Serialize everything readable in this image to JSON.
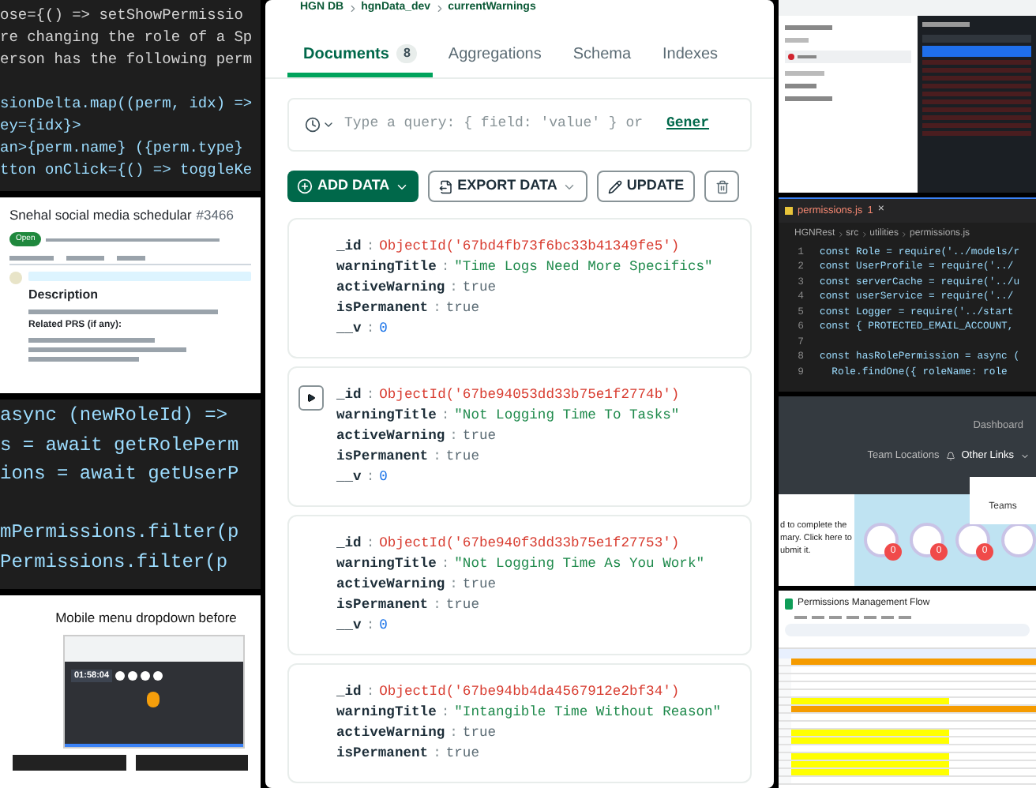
{
  "code_top": {
    "blocks": [
      [
        "ose={() => setShowPermissio",
        "re changing the role of a Sp",
        "erson has the following perm"
      ],
      [
        "sionDelta.map((perm, idx) =>",
        "ey={idx}>",
        "an>{perm.name} ({perm.type}",
        "tton onClick={() => toggleKe"
      ]
    ]
  },
  "issue": {
    "title": "Snehal social media schedular",
    "number": "#3466",
    "status": "Open",
    "heading": "Description",
    "related": "Related PRS (if any):"
  },
  "code_mid": {
    "blocks": [
      [
        "async (newRoleId) =>",
        "s = await getRolePerm",
        "ions = await getUserP"
      ],
      [
        "mPermissions.filter(p",
        "Permissions.filter(p"
      ]
    ]
  },
  "mobile_menu": {
    "caption": "Mobile menu dropdown before",
    "timer": "01:58:04"
  },
  "compass": {
    "separator": ":",
    "breadcrumb": [
      "HGN DB",
      "hgnData_dev",
      "currentWarnings"
    ],
    "tabs": [
      {
        "label": "Documents",
        "count": "8",
        "selected": true
      },
      {
        "label": "Aggregations",
        "selected": false
      },
      {
        "label": "Schema",
        "selected": false
      },
      {
        "label": "Indexes",
        "selected": false
      }
    ],
    "query": {
      "placeholder": "Type a query: { field: 'value' } or",
      "link": "Gener"
    },
    "buttons": [
      {
        "label": "ADD DATA",
        "kind": "primary"
      },
      {
        "label": "EXPORT DATA",
        "kind": "export"
      },
      {
        "label": "UPDATE",
        "kind": "update"
      },
      {
        "kind": "delete"
      }
    ],
    "documents": [
      {
        "expandable": false,
        "fields": [
          {
            "key": "_id",
            "value": "ObjectId('67bd4fb73f6bc33b41349fe5')",
            "kind": "oid"
          },
          {
            "key": "warningTitle",
            "value": "\"Time Logs Need More Specifics\"",
            "kind": "string"
          },
          {
            "key": "activeWarning",
            "value": "true",
            "kind": "bool"
          },
          {
            "key": "isPermanent",
            "value": "true",
            "kind": "bool"
          },
          {
            "key": "__v",
            "value": "0",
            "kind": "number"
          }
        ]
      },
      {
        "expandable": true,
        "fields": [
          {
            "key": "_id",
            "value": "ObjectId('67be94053dd33b75e1f2774b')",
            "kind": "oid"
          },
          {
            "key": "warningTitle",
            "value": "\"Not Logging Time To Tasks\"",
            "kind": "string"
          },
          {
            "key": "activeWarning",
            "value": "true",
            "kind": "bool"
          },
          {
            "key": "isPermanent",
            "value": "true",
            "kind": "bool"
          },
          {
            "key": "__v",
            "value": "0",
            "kind": "number"
          }
        ]
      },
      {
        "expandable": false,
        "fields": [
          {
            "key": "_id",
            "value": "ObjectId('67be940f3dd33b75e1f27753')",
            "kind": "oid"
          },
          {
            "key": "warningTitle",
            "value": "\"Not Logging Time As You Work\"",
            "kind": "string"
          },
          {
            "key": "activeWarning",
            "value": "true",
            "kind": "bool"
          },
          {
            "key": "isPermanent",
            "value": "true",
            "kind": "bool"
          },
          {
            "key": "__v",
            "value": "0",
            "kind": "number"
          }
        ]
      },
      {
        "expandable": false,
        "fields": [
          {
            "key": "_id",
            "value": "ObjectId('67be94bb4da4567912e2bf34')",
            "kind": "oid"
          },
          {
            "key": "warningTitle",
            "value": "\"Intangible Time Without Reason\"",
            "kind": "string"
          },
          {
            "key": "activeWarning",
            "value": "true",
            "kind": "bool"
          },
          {
            "key": "isPermanent",
            "value": "true",
            "kind": "bool"
          }
        ]
      }
    ]
  },
  "editor": {
    "tab": "permissions.js",
    "tab_badge": "1",
    "close": "×",
    "breadcrumb": [
      "HGNRest",
      "src",
      "utilities",
      "permissions.js"
    ],
    "lines": [
      {
        "n": "1",
        "text": "const Role = require('../models/r"
      },
      {
        "n": "2",
        "text": "const UserProfile = require('../"
      },
      {
        "n": "3",
        "text": "const serverCache = require('../u"
      },
      {
        "n": "4",
        "text": "const userService = require('../"
      },
      {
        "n": "5",
        "text": "const Logger = require('../start"
      },
      {
        "n": "6",
        "text": "const { PROTECTED_EMAIL_ACCOUNT,"
      },
      {
        "n": "7"
      },
      {
        "n": "8",
        "text": "const hasRolePermission = async ("
      },
      {
        "n": "9",
        "text": "  Role.findOne({ roleName: role"
      }
    ]
  },
  "dashboard": {
    "nav_right": "Dashboard",
    "links": [
      "Team Locations",
      "Other Links"
    ],
    "dropdown_item": "Teams",
    "message": [
      "d to complete the",
      "mary. Click here to",
      "ubmit it."
    ],
    "badges": [
      {
        "kind": "counted",
        "count": "0"
      },
      {
        "kind": "counted",
        "count": "0"
      },
      {
        "kind": "counted",
        "count": "0"
      },
      {
        "kind": "plain"
      }
    ]
  },
  "sheet": {
    "title": "Permissions Management Flow"
  }
}
